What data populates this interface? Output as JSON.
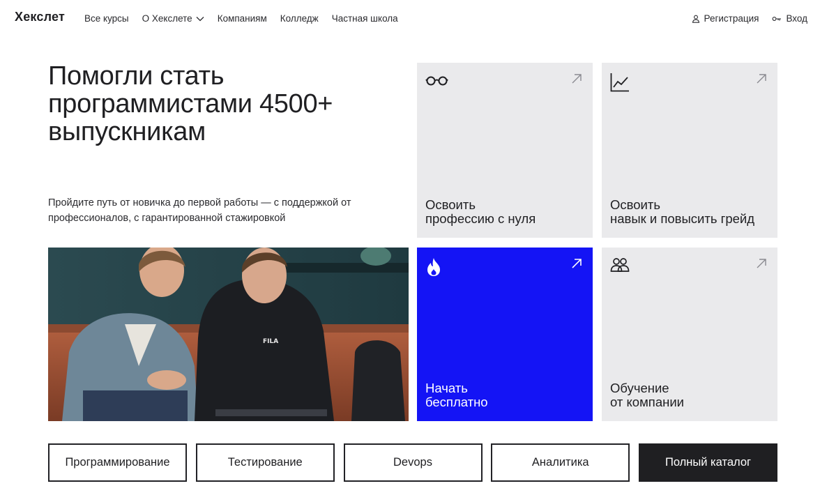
{
  "header": {
    "logo": "Хекслет",
    "nav": [
      {
        "label": "Все курсы"
      },
      {
        "label": "О Хекслете",
        "has_dropdown": true
      },
      {
        "label": "Компаниям"
      },
      {
        "label": "Колледж"
      },
      {
        "label": "Частная школа"
      }
    ],
    "register_label": "Регистрация",
    "login_label": "Вход"
  },
  "hero": {
    "title": "Помогли стать программистами 4500+ выпускникам",
    "subtitle": "Пройдите путь от новичка до первой работы — с поддержкой от профессионалов, с гарантированной стажировкой"
  },
  "cards": [
    {
      "label": "Освоить\nпрофессию с нуля",
      "icon": "glasses-icon"
    },
    {
      "label": "Освоить\nнавык и повысить грейд",
      "icon": "chart-line-icon"
    },
    {
      "label": "Начать\nбесплатно",
      "icon": "fire-icon",
      "accent": "#1414f5"
    },
    {
      "label": "Обучение\nот компании",
      "icon": "users-icon"
    }
  ],
  "categories": [
    {
      "label": "Программирование"
    },
    {
      "label": "Тестирование"
    },
    {
      "label": "Devops"
    },
    {
      "label": "Аналитика"
    },
    {
      "label": "Полный каталог"
    }
  ],
  "colors": {
    "accent": "#1414f5",
    "card_bg": "#eaeaec",
    "dark": "#1f1f22"
  }
}
